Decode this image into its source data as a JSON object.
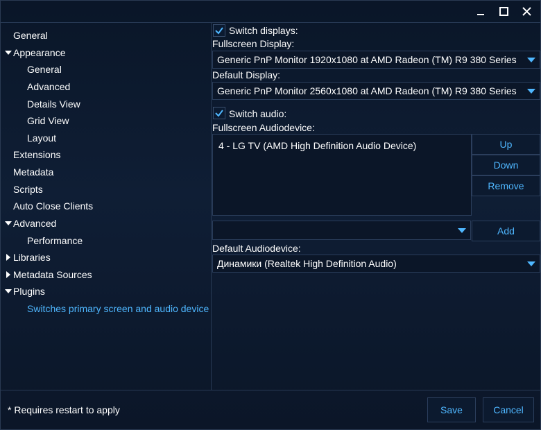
{
  "window": {
    "controls": {
      "minimize_icon": "minimize-icon",
      "maximize_icon": "maximize-icon",
      "close_icon": "close-icon"
    }
  },
  "sidebar": {
    "items": [
      {
        "label": "General"
      },
      {
        "label": "Appearance",
        "expanded": true
      },
      {
        "label": "General"
      },
      {
        "label": "Advanced"
      },
      {
        "label": "Details View"
      },
      {
        "label": "Grid View"
      },
      {
        "label": "Layout"
      },
      {
        "label": "Extensions"
      },
      {
        "label": "Metadata"
      },
      {
        "label": "Scripts"
      },
      {
        "label": "Auto Close Clients"
      },
      {
        "label": "Advanced",
        "expanded": true
      },
      {
        "label": "Performance"
      },
      {
        "label": "Libraries",
        "expanded": false
      },
      {
        "label": "Metadata Sources",
        "expanded": false
      },
      {
        "label": "Plugins",
        "expanded": true
      },
      {
        "label": "Switches primary screen and audio device",
        "selected": true
      }
    ]
  },
  "panel": {
    "switch_displays": {
      "label": "Switch displays:",
      "checked": true
    },
    "fullscreen_display": {
      "label": "Fullscreen Display:",
      "value": "Generic PnP Monitor 1920x1080 at AMD Radeon (TM) R9 380 Series"
    },
    "default_display": {
      "label": "Default Display:",
      "value": "Generic PnP Monitor 2560x1080 at AMD Radeon (TM) R9 380 Series"
    },
    "switch_audio": {
      "label": "Switch audio:",
      "checked": true
    },
    "fullscreen_audiodevice": {
      "label": "Fullscreen Audiodevice:",
      "items": [
        "4 - LG TV (AMD High Definition Audio Device)"
      ],
      "up_label": "Up",
      "down_label": "Down",
      "remove_label": "Remove",
      "add_value": "",
      "add_label": "Add"
    },
    "default_audiodevice": {
      "label": "Default Audiodevice:",
      "value": "Динамики (Realtek High Definition Audio)"
    }
  },
  "footer": {
    "note": "* Requires restart to apply",
    "save_label": "Save",
    "cancel_label": "Cancel"
  },
  "colors": {
    "accent": "#4fb7ff",
    "background": "#0d1a2c",
    "border": "#2b3e5c",
    "text": "#ffffff"
  }
}
